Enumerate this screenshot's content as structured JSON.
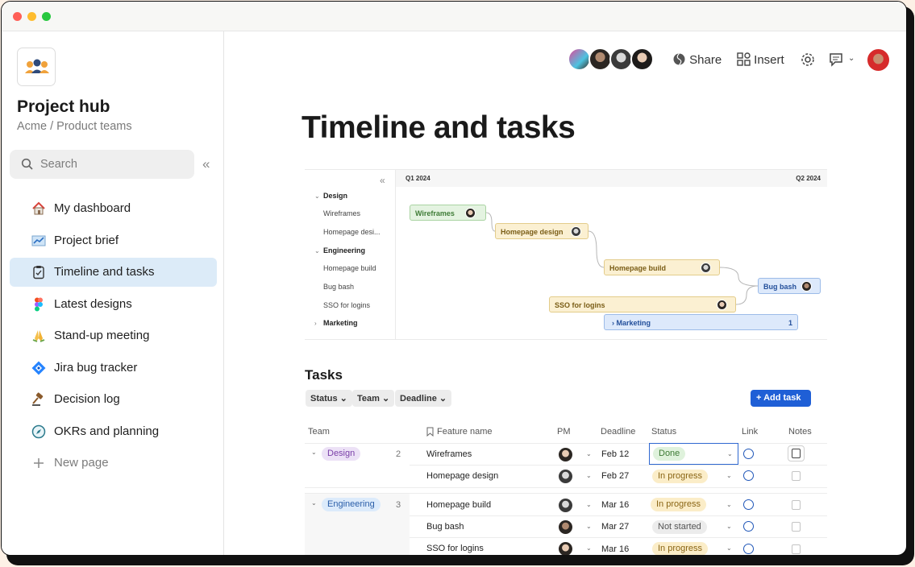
{
  "window": {
    "dots": [
      "#ff5f57",
      "#febc2e",
      "#28c840"
    ]
  },
  "sidebar": {
    "workspace_title": "Project hub",
    "workspace_subtitle": "Acme / Product teams",
    "search_placeholder": "Search",
    "collapse_icon": "«",
    "items": [
      {
        "label": "My dashboard",
        "icon": "house-icon"
      },
      {
        "label": "Project brief",
        "icon": "chart-icon"
      },
      {
        "label": "Timeline and tasks",
        "icon": "clipboard-icon",
        "active": true
      },
      {
        "label": "Latest designs",
        "icon": "figma-icon"
      },
      {
        "label": "Stand-up meeting",
        "icon": "hands-icon"
      },
      {
        "label": "Jira bug tracker",
        "icon": "jira-icon"
      },
      {
        "label": "Decision log",
        "icon": "gavel-icon"
      },
      {
        "label": "OKRs and planning",
        "icon": "compass-icon"
      }
    ],
    "new_page_label": "New page"
  },
  "topbar": {
    "share_label": "Share",
    "insert_label": "Insert"
  },
  "page": {
    "title": "Timeline and tasks"
  },
  "timeline": {
    "collapse_icon": "«",
    "q1_label": "Q1 2024",
    "q2_label": "Q2 2024",
    "rows": [
      {
        "label": "Design",
        "group": true,
        "caret": "⌄"
      },
      {
        "label": "Wireframes"
      },
      {
        "label": "Homepage desi..."
      },
      {
        "label": "Engineering",
        "group": true,
        "caret": "⌄"
      },
      {
        "label": "Homepage build"
      },
      {
        "label": "Bug bash"
      },
      {
        "label": "SSO for logins"
      },
      {
        "label": "Marketing",
        "group": true,
        "caret": "›"
      }
    ],
    "bars": [
      {
        "label": "Wireframes",
        "color": "green"
      },
      {
        "label": "Homepage design",
        "color": "yellow"
      },
      {
        "label": "Homepage build",
        "color": "yellow"
      },
      {
        "label": "Bug bash",
        "color": "blue"
      },
      {
        "label": "SSO for logins",
        "color": "yellow"
      },
      {
        "label": "› Marketing",
        "count": "1",
        "color": "blue"
      }
    ]
  },
  "tasks": {
    "heading": "Tasks",
    "filters": [
      "Status ⌄",
      "Team ⌄",
      "Deadline ⌄"
    ],
    "add_task_label": "+ Add task",
    "columns": [
      "Team",
      "Feature name",
      "PM",
      "Deadline",
      "Status",
      "Link",
      "Notes"
    ],
    "groups": [
      {
        "team": "Design",
        "count": "2",
        "rows": [
          {
            "feature": "Wireframes",
            "deadline": "Feb 12",
            "status": "Done"
          },
          {
            "feature": "Homepage design",
            "deadline": "Feb 27",
            "status": "In progress"
          }
        ]
      },
      {
        "team": "Engineering",
        "count": "3",
        "rows": [
          {
            "feature": "Homepage build",
            "deadline": "Mar 16",
            "status": "In progress"
          },
          {
            "feature": "Bug bash",
            "deadline": "Mar 27",
            "status": "Not started"
          },
          {
            "feature": "SSO for logins",
            "deadline": "Mar 16",
            "status": "In progress"
          }
        ]
      }
    ]
  }
}
